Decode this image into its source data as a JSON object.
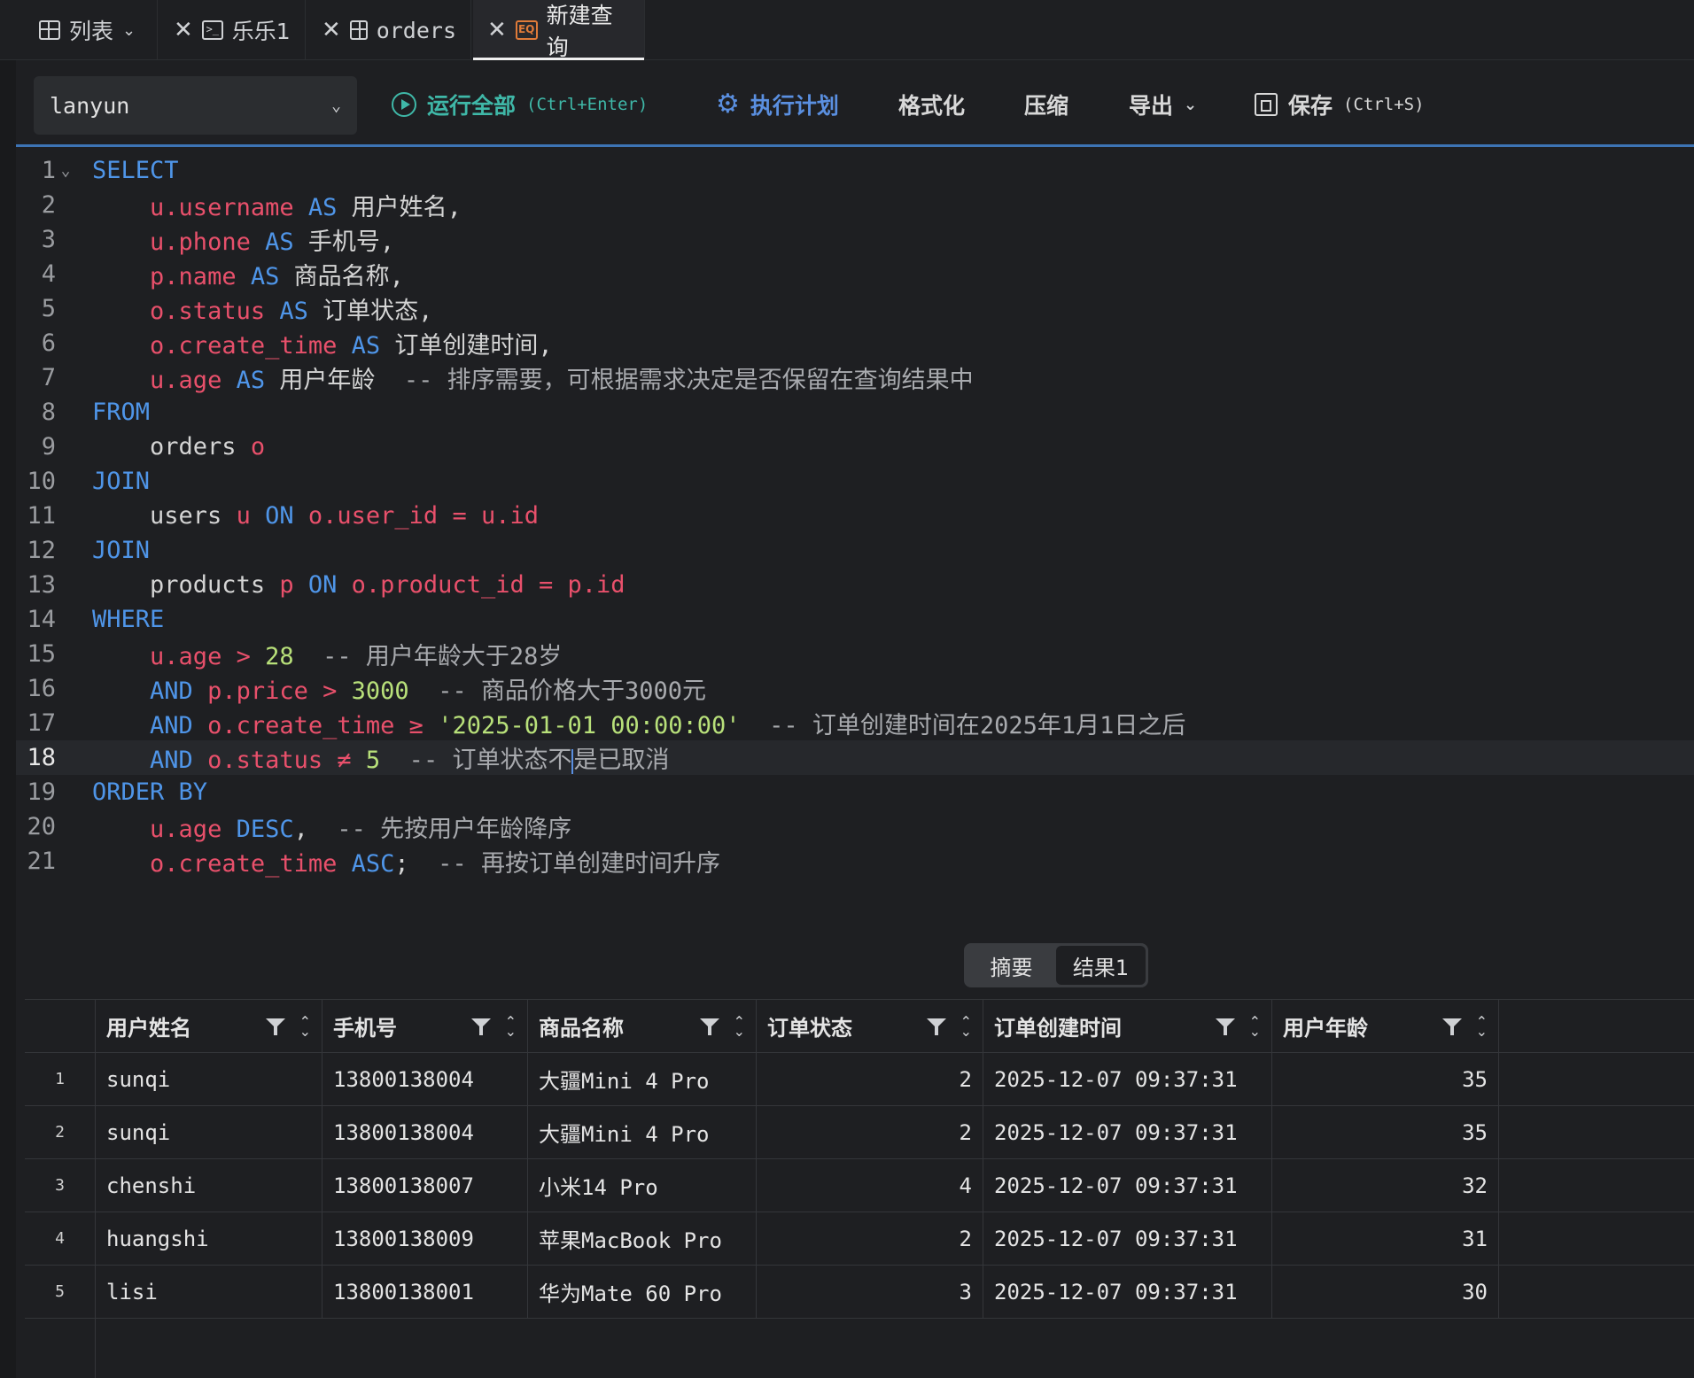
{
  "tabs": [
    {
      "label": "列表",
      "icon": "table-icon"
    },
    {
      "label": "乐乐1",
      "icon": "terminal-icon"
    },
    {
      "label": "orders",
      "icon": "table-icon"
    },
    {
      "label": "新建查询",
      "icon": "query-icon"
    }
  ],
  "toolbar": {
    "database": "lanyun",
    "run_all": "运行全部",
    "run_all_hint": "(Ctrl+Enter)",
    "plan": "执行计划",
    "format": "格式化",
    "compress": "压缩",
    "export": "导出",
    "save": "保存",
    "save_hint": "(Ctrl+S)"
  },
  "editor": {
    "current_line": 18,
    "line_numbers": [
      "1",
      "2",
      "3",
      "4",
      "5",
      "6",
      "7",
      "8",
      "9",
      "10",
      "11",
      "12",
      "13",
      "14",
      "15",
      "16",
      "17",
      "18",
      "19",
      "20",
      "21"
    ],
    "tokens": {
      "l1": [
        "SELECT"
      ],
      "l2": [
        "u",
        ".username",
        " AS ",
        "用户姓名,"
      ],
      "l3": [
        "u",
        ".phone",
        " AS ",
        "手机号,"
      ],
      "l4": [
        "p",
        ".name",
        " AS ",
        "商品名称,"
      ],
      "l5": [
        "o",
        ".status",
        " AS ",
        "订单状态,"
      ],
      "l6": [
        "o",
        ".create_time",
        " AS ",
        "订单创建时间,"
      ],
      "l7": [
        "u",
        ".age",
        " AS ",
        "用户年龄  ",
        "-- 排序需要，可根据需求决定是否保留在查询结果中"
      ],
      "l8": [
        "FROM"
      ],
      "l9": [
        "orders ",
        "o"
      ],
      "l10": [
        "JOIN"
      ],
      "l11": [
        "users ",
        "u",
        " ON ",
        "o",
        ".user_id",
        " = ",
        "u",
        ".id"
      ],
      "l12": [
        "JOIN"
      ],
      "l13": [
        "products ",
        "p",
        " ON ",
        "o",
        ".product_id",
        " = ",
        "p",
        ".id"
      ],
      "l14": [
        "WHERE"
      ],
      "l15": [
        "u",
        ".age",
        " > ",
        "28",
        "  -- 用户年龄大于28岁"
      ],
      "l16": [
        "AND ",
        "p",
        ".price",
        " > ",
        "3000",
        "  -- 商品价格大于3000元"
      ],
      "l17": [
        "AND ",
        "o",
        ".create_time",
        " ≥ ",
        "'2025-01-01 00:00:00'",
        "  -- 订单创建时间在2025年1月1日之后"
      ],
      "l18": [
        "AND ",
        "o",
        ".status",
        " ≠ ",
        "5",
        "  -- 订单状态不",
        "是已取消"
      ],
      "l19": [
        "ORDER BY"
      ],
      "l20": [
        "u",
        ".age",
        " DESC",
        ",",
        "  -- 先按用户年龄降序"
      ],
      "l21": [
        "o",
        ".create_time",
        " ASC",
        ";",
        "  -- 再按订单创建时间升序"
      ]
    }
  },
  "result_tabs": [
    "摘要",
    "结果1"
  ],
  "grid": {
    "columns": [
      "用户姓名",
      "手机号",
      "商品名称",
      "订单状态",
      "订单创建时间",
      "用户年龄"
    ],
    "rows": [
      {
        "idx": "1",
        "cells": [
          "sunqi",
          "13800138004",
          "大疆Mini 4 Pro",
          "2",
          "2025-12-07 09:37:31",
          "35"
        ]
      },
      {
        "idx": "2",
        "cells": [
          "sunqi",
          "13800138004",
          "大疆Mini 4 Pro",
          "2",
          "2025-12-07 09:37:31",
          "35"
        ]
      },
      {
        "idx": "3",
        "cells": [
          "chenshi",
          "13800138007",
          "小米14 Pro",
          "4",
          "2025-12-07 09:37:31",
          "32"
        ]
      },
      {
        "idx": "4",
        "cells": [
          "huangshi",
          "13800138009",
          "苹果MacBook Pro",
          "2",
          "2025-12-07 09:37:31",
          "31"
        ]
      },
      {
        "idx": "5",
        "cells": [
          "lisi",
          "13800138001",
          "华为Mate 60 Pro",
          "3",
          "2025-12-07 09:37:31",
          "30"
        ]
      }
    ]
  },
  "colors": {
    "keyword": "#4f95e8",
    "alias": "#e8506b",
    "number": "#b8e07a",
    "comment": "#a8aaae",
    "run": "#3fb8a8",
    "accent": "#3d74b5"
  }
}
